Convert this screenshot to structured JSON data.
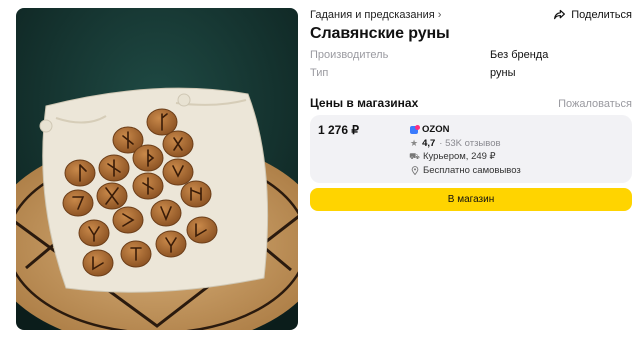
{
  "breadcrumb": {
    "label": "Гадания и предсказания",
    "chevron": "›"
  },
  "share": {
    "label": "Поделиться",
    "icon": "share-icon"
  },
  "product": {
    "title": "Славянские руны",
    "image_icon": "rune-stones-photo",
    "properties": [
      {
        "key": "Производитель",
        "value": "Без бренда"
      },
      {
        "key": "Тип",
        "value": "руны"
      }
    ]
  },
  "prices": {
    "title": "Цены в магазинах",
    "complain_label": "Пожаловаться",
    "offer": {
      "price": "1 276 ₽",
      "shop_name": "OZON",
      "rating": "4,7",
      "reviews": "53K отзывов",
      "delivery": "Курьером, 249 ₽",
      "pickup": "Бесплатно самовывоз"
    },
    "button_label": "В магазин"
  },
  "colors": {
    "accent": "#ffd400",
    "muted": "#9a9aa0",
    "card_bg": "#f2f2f5",
    "ozon_blue": "#3a7bfd"
  }
}
